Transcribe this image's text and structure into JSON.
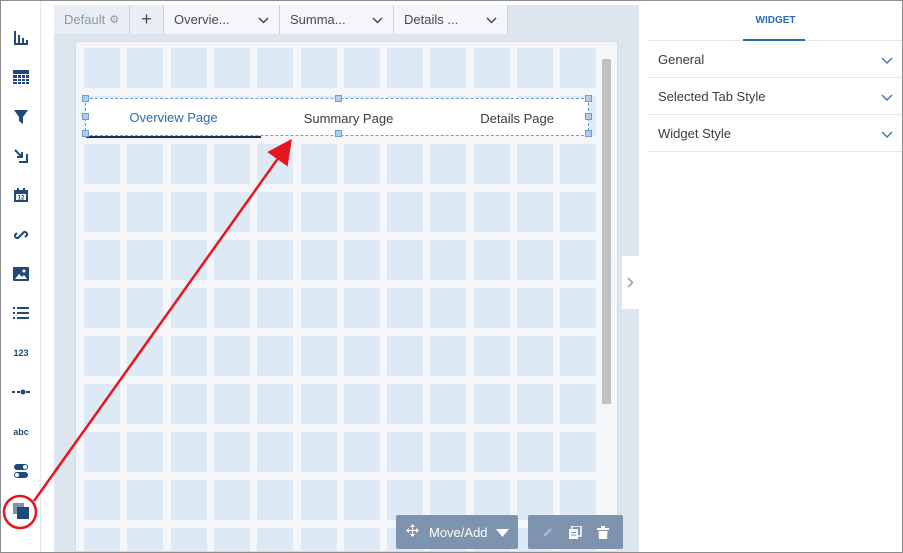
{
  "page_tabs": {
    "default_label": "Default",
    "add_label": "+",
    "tabs": [
      {
        "label": "Overvie..."
      },
      {
        "label": "Summa..."
      },
      {
        "label": "Details ..."
      }
    ]
  },
  "tab_widget": {
    "tabs": [
      {
        "label": "Overview Page"
      },
      {
        "label": "Summary Page"
      },
      {
        "label": "Details Page"
      }
    ]
  },
  "toolbar_tools": [
    {
      "icon": "chart-icon"
    },
    {
      "icon": "table-icon"
    },
    {
      "icon": "filter-icon"
    },
    {
      "icon": "compare-icon"
    },
    {
      "icon": "calendar-icon",
      "text": "12"
    },
    {
      "icon": "link-icon"
    },
    {
      "icon": "image-icon"
    },
    {
      "icon": "list-icon"
    },
    {
      "icon": "number-icon",
      "text": "123"
    },
    {
      "icon": "range-icon"
    },
    {
      "icon": "text-icon",
      "text": "abc"
    },
    {
      "icon": "toggle-icon"
    },
    {
      "icon": "container-icon"
    }
  ],
  "bottom_toolbar": {
    "move_add_label": "Move/Add"
  },
  "right_panel": {
    "header": "WIDGET",
    "sections": [
      {
        "label": "General"
      },
      {
        "label": "Selected Tab Style"
      },
      {
        "label": "Widget Style"
      }
    ]
  },
  "colors": {
    "accent": "#2b6cb0",
    "annotation_red": "#e8141e",
    "grid_cell": "#dde9f4"
  }
}
